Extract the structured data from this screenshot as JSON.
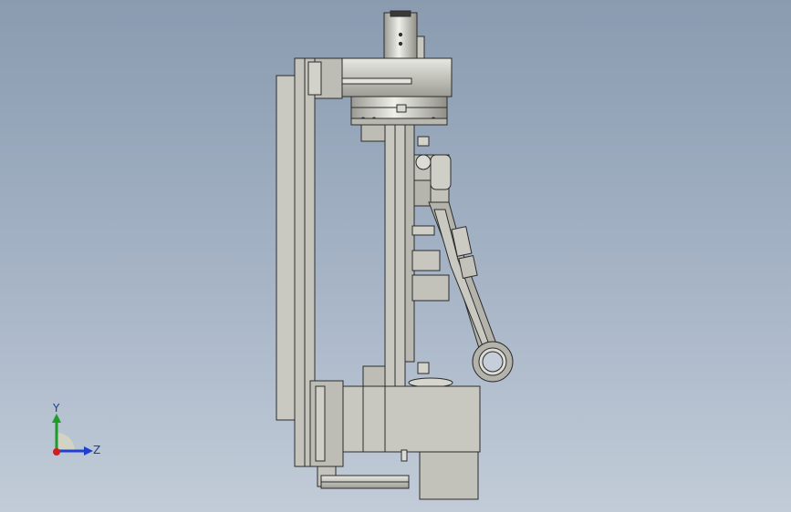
{
  "viewport": {
    "background_top": "#8a9bb0",
    "background_bottom": "#c2ccd8"
  },
  "model": {
    "part_fill": "#c4c4bd",
    "part_fill_dark": "#a8a8a0",
    "part_fill_light": "#dcdcd6",
    "edge_color": "#2b2b2b",
    "arm_fill": "#b3b3ab"
  },
  "triad": {
    "y_label": "Y",
    "z_label": "Z",
    "y_color": "#1d9c2a",
    "z_color": "#1f3fd0",
    "x_color": "#d01f1f"
  }
}
